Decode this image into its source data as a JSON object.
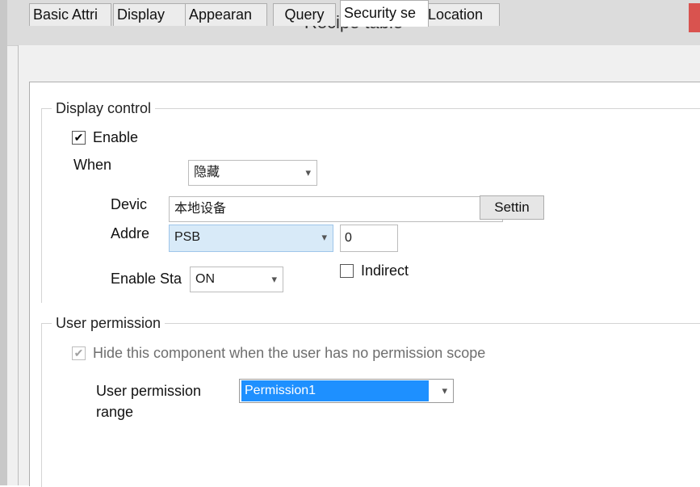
{
  "window": {
    "title": "Recipe table"
  },
  "tabs": [
    {
      "label": "Basic Attri"
    },
    {
      "label": "Display"
    },
    {
      "label": "Appearan"
    },
    {
      "label": "Query"
    },
    {
      "label": "Security se"
    },
    {
      "label": "Location"
    }
  ],
  "active_tab_index": 4,
  "display_control": {
    "legend": "Display control",
    "enable_label": "Enable",
    "enable_checked": true,
    "when_label": "When",
    "when_value": "隐藏",
    "device_label": "Devic",
    "device_value": "本地设备",
    "settings_button": "Settin",
    "address_label": "Addre",
    "address_type": "PSB",
    "address_value": "0",
    "enable_state_label": "Enable Sta",
    "enable_state_value": "ON",
    "indirect_label": "Indirect",
    "indirect_checked": false
  },
  "user_permission": {
    "legend": "User permission",
    "hide_label": "Hide this component when the user has no permission scope",
    "hide_checked": true,
    "range_label_line1": "User permission",
    "range_label_line2": "range",
    "range_value": "Permission1"
  },
  "colors": {
    "selection_blue": "#1e90ff",
    "address_highlight": "#d8eaf8"
  }
}
